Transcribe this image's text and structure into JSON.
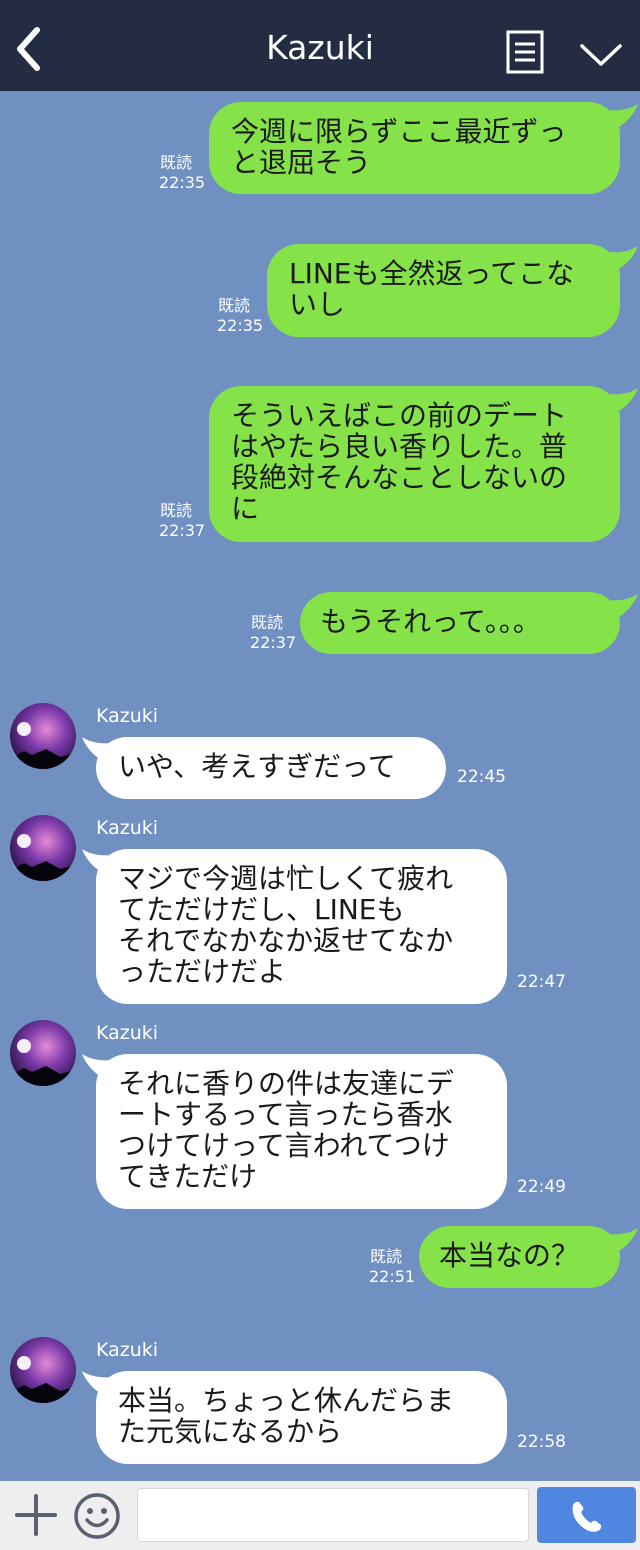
{
  "header": {
    "title": "Kazuki"
  },
  "labels": {
    "read": "既読"
  },
  "messages": [
    {
      "dir": "out",
      "text": "今週に限らずここ最近ずっ\nと退屈そう",
      "time": "22:35"
    },
    {
      "dir": "out",
      "text": "LINEも全然返ってこな\nいし",
      "time": "22:35"
    },
    {
      "dir": "out",
      "text": "そういえばこの前のデート\nはやたら良い香りした。普\n段絶対そんなことしないの\nに",
      "time": "22:37"
    },
    {
      "dir": "out",
      "text": "もうそれって。。。",
      "time": "22:37"
    },
    {
      "dir": "in",
      "name": "Kazuki",
      "text": "いや、考えすぎだって",
      "time": "22:45"
    },
    {
      "dir": "in",
      "name": "Kazuki",
      "text": "マジで今週は忙しくて疲れ\nてただけだし、LINEも\nそれでなかなか返せてなか\nっただけだよ",
      "time": "22:47"
    },
    {
      "dir": "in",
      "name": "Kazuki",
      "text": "それに香りの件は友達にデ\nートするって言ったら香水\nつけてけって言われてつけ\nてきただけ",
      "time": "22:49"
    },
    {
      "dir": "out",
      "text": "本当なの？",
      "time": "22:51"
    },
    {
      "dir": "in",
      "name": "Kazuki",
      "text": "本当。ちょっと休んだらま\nた元気になるから",
      "time": "22:58"
    }
  ],
  "composer": {
    "placeholder": ""
  },
  "icons": {
    "back": "chevron-left-icon",
    "notes": "notes-icon",
    "menu": "chevron-down-icon",
    "plus": "plus-icon",
    "emoji": "smiley-icon",
    "send": "phone-icon"
  },
  "colors": {
    "header": "#232c42",
    "background": "#7190c2",
    "outgoing": "#85e249",
    "incoming": "#ffffff",
    "send": "#4f86e0"
  }
}
